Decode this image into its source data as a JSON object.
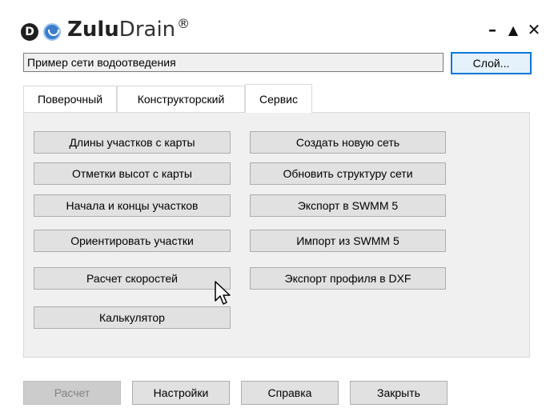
{
  "app": {
    "name_bold": "Zulu",
    "name_light": "Drain",
    "trademark": "®",
    "logo_letter": "D"
  },
  "window_controls": {
    "minimize": "–",
    "maximize": "▲",
    "close": "✕"
  },
  "network": {
    "name": "Пример сети водоотведения",
    "layer_button": "Слой..."
  },
  "tabs": [
    {
      "label": "Поверочный",
      "active": false
    },
    {
      "label": "Конструкторский",
      "active": false
    },
    {
      "label": "Сервис",
      "active": true
    }
  ],
  "service_buttons": {
    "left": [
      "Длины участков с карты",
      "Отметки высот с карты",
      "Начала и концы участков",
      "Ориентировать участки",
      "Расчет скоростей",
      "Калькулятор"
    ],
    "right": [
      "Создать новую сеть",
      "Обновить структуру сети",
      "Экспорт в SWMM 5",
      "Импорт из SWMM 5",
      "Экспорт профиля в DXF"
    ]
  },
  "footer": {
    "calculate": "Расчет",
    "settings": "Настройки",
    "help": "Справка",
    "close": "Закрыть"
  },
  "colors": {
    "logo_dark": "#1f1f1f",
    "logo_blue": "#3d7ecb",
    "panel_bg": "#f0f0f0",
    "focus_border": "#0078d7",
    "button_bg": "#e1e1e1"
  },
  "icons": {
    "logo_left": "letter-d-circle-icon",
    "logo_right": "smiley-drop-icon",
    "pointer": "mouse-cursor-icon"
  }
}
